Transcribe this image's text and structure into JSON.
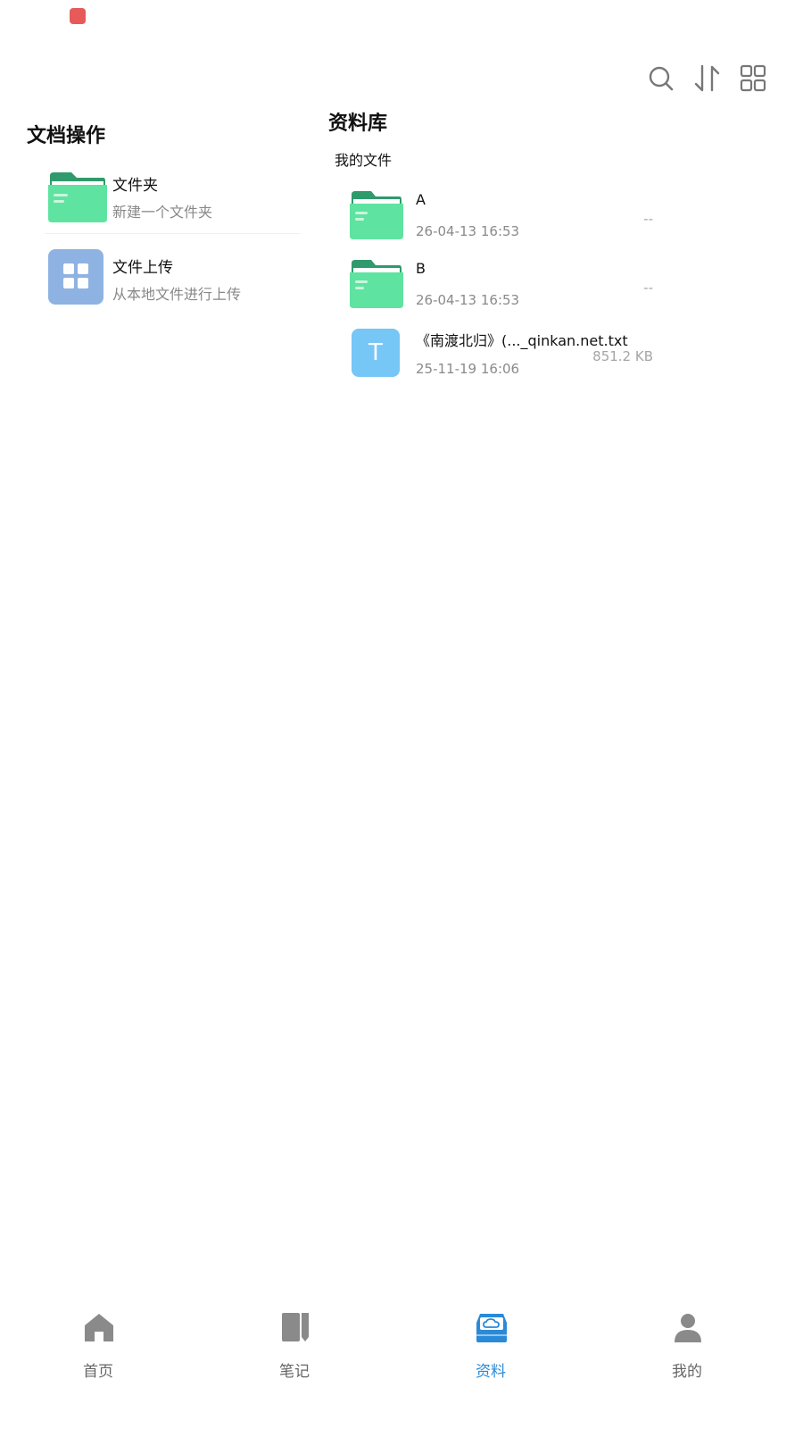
{
  "status": {
    "app_badge": "app-badge"
  },
  "toolbar": {
    "icons": [
      "search-icon",
      "sort-icon",
      "grid-view-icon"
    ]
  },
  "left": {
    "title": "文档操作",
    "items": [
      {
        "title": "文件夹",
        "subtitle": "新建一个文件夹",
        "icon": "folder-icon"
      },
      {
        "title": "文件上传",
        "subtitle": "从本地文件进行上传",
        "icon": "apps-grid-icon"
      }
    ]
  },
  "right": {
    "title": "资料库",
    "section": "我的文件",
    "files": [
      {
        "name": "A",
        "date": "26-04-13 16:53",
        "size": "--",
        "icon": "folder-icon"
      },
      {
        "name": "B",
        "date": "26-04-13 16:53",
        "size": "--",
        "icon": "folder-icon"
      },
      {
        "name": "《南渡北归》(..._qinkan.net.txt",
        "date": "25-11-19 16:06",
        "size": "851.2 KB",
        "icon": "text-file-icon",
        "icon_letter": "T"
      }
    ]
  },
  "bottom_nav": {
    "items": [
      {
        "label": "首页",
        "icon": "home-icon"
      },
      {
        "label": "笔记",
        "icon": "notebook-icon"
      },
      {
        "label": "资料",
        "icon": "cloud-drive-icon",
        "active": true
      },
      {
        "label": "我的",
        "icon": "person-icon"
      }
    ]
  },
  "colors": {
    "accent": "#2a8ad8",
    "folder_green": "#5fe3a0",
    "folder_green_dark": "#2f9a6c",
    "text_file_blue": "#76c6f6",
    "upload_tile": "#8eb3e2"
  }
}
